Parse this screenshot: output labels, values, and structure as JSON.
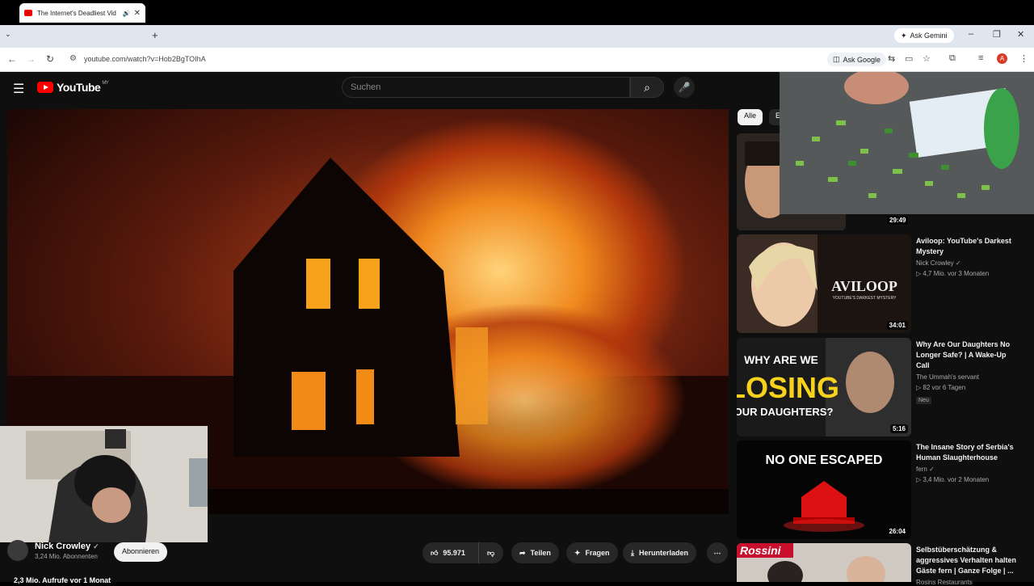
{
  "browser": {
    "tab_title": "The Internet's Deadliest Vid",
    "url": "youtube.com/watch?v=Hob2BgTOIhA",
    "ask_gemini": "Ask Gemini",
    "ask_google": "Ask Google",
    "profile_initial": "A"
  },
  "youtube": {
    "logo_text": "YouTube",
    "region": "MY",
    "search_placeholder": "Suchen"
  },
  "video": {
    "channel_name": "Nick Crowley",
    "subscribers": "3,24 Mio. Abonnenten",
    "subscribe_label": "Abonnieren",
    "likes": "95.971",
    "share_label": "Teilen",
    "ask_label": "Fragen",
    "download_label": "Herunterladen",
    "stats": "2,3 Mio. Aufrufe  vor 1 Monat"
  },
  "chips": [
    "Alle",
    "Er"
  ],
  "recommendations": [
    {
      "title": "",
      "channel": "",
      "views": "",
      "duration": "29:49"
    },
    {
      "title": "Aviloop: YouTube's Darkest Mystery",
      "channel": "Nick Crowley",
      "views": "▷ 4,7 Mio.  vor 3 Monaten",
      "duration": "34:01",
      "thumb_text": "AVILOOP",
      "thumb_sub": "YOUTUBE'S DARKEST MYSTERY"
    },
    {
      "title": "Why Are Our Daughters No Longer Safe? | A Wake-Up Call",
      "channel": "The Ummah's servant",
      "views": "▷ 82  vor 6 Tagen",
      "badge": "Neu",
      "duration": "5:16",
      "thumb_text1": "WHY ARE WE",
      "thumb_text2": "LOSING",
      "thumb_text3": "OUR DAUGHTERS?"
    },
    {
      "title": "The Insane Story of Serbia's Human Slaughterhouse",
      "channel": "fern",
      "views": "▷ 3,4 Mio.  vor 2 Monaten",
      "duration": "26:04",
      "thumb_text": "NO ONE ESCAPED"
    },
    {
      "title": "Selbstüberschätzung & aggressives Verhalten halten Gäste fern | Ganze Folge | ...",
      "channel": "Rosins Restaurants",
      "thumb_text": "Rossini"
    }
  ]
}
